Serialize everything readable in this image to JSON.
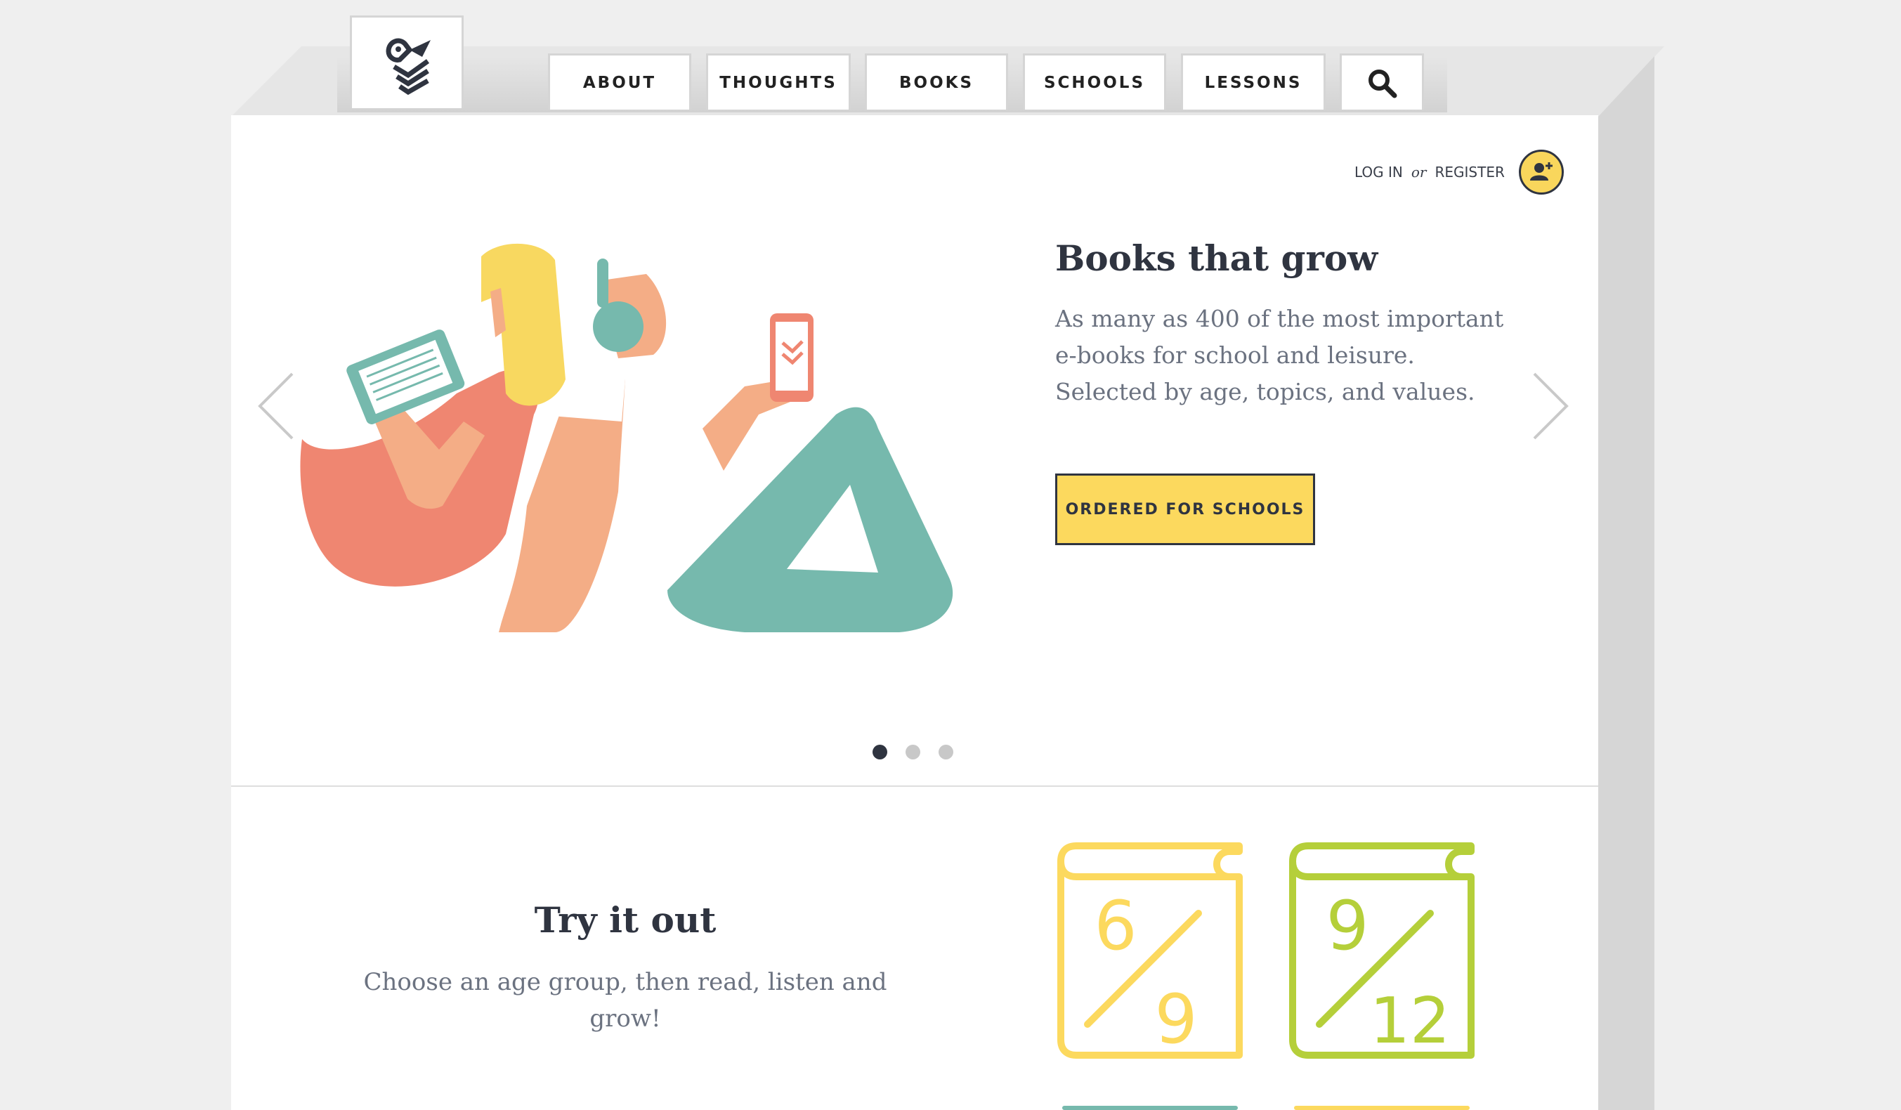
{
  "nav": {
    "items": [
      {
        "label": "ABOUT"
      },
      {
        "label": "THOUGHTS"
      },
      {
        "label": "BOOKS"
      },
      {
        "label": "SCHOOLS"
      },
      {
        "label": "LESSONS"
      }
    ],
    "search_icon": "search-icon"
  },
  "auth": {
    "login": "LOG IN",
    "or": "or",
    "register": "REGISTER",
    "icon": "add-user-icon"
  },
  "hero": {
    "title": "Books that grow",
    "text": "As many as 400 of the most important e-books for school and leisure. Selected by age, topics, and values.",
    "cta": "ORDERED FOR SCHOOLS",
    "slides_total": 3,
    "active_slide": 1
  },
  "try": {
    "title": "Try it out",
    "text": "Choose an age group, then read, listen and grow!",
    "groups": [
      {
        "top": "6",
        "bottom": "9",
        "color": "#fcd95e"
      },
      {
        "top": "9",
        "bottom": "12",
        "color": "#b5cf3a"
      }
    ]
  },
  "colors": {
    "yellow": "#fcd95e",
    "green": "#b5cf3a",
    "teal": "#76b9ad",
    "coral": "#ef8671",
    "dark": "#2f3440"
  }
}
